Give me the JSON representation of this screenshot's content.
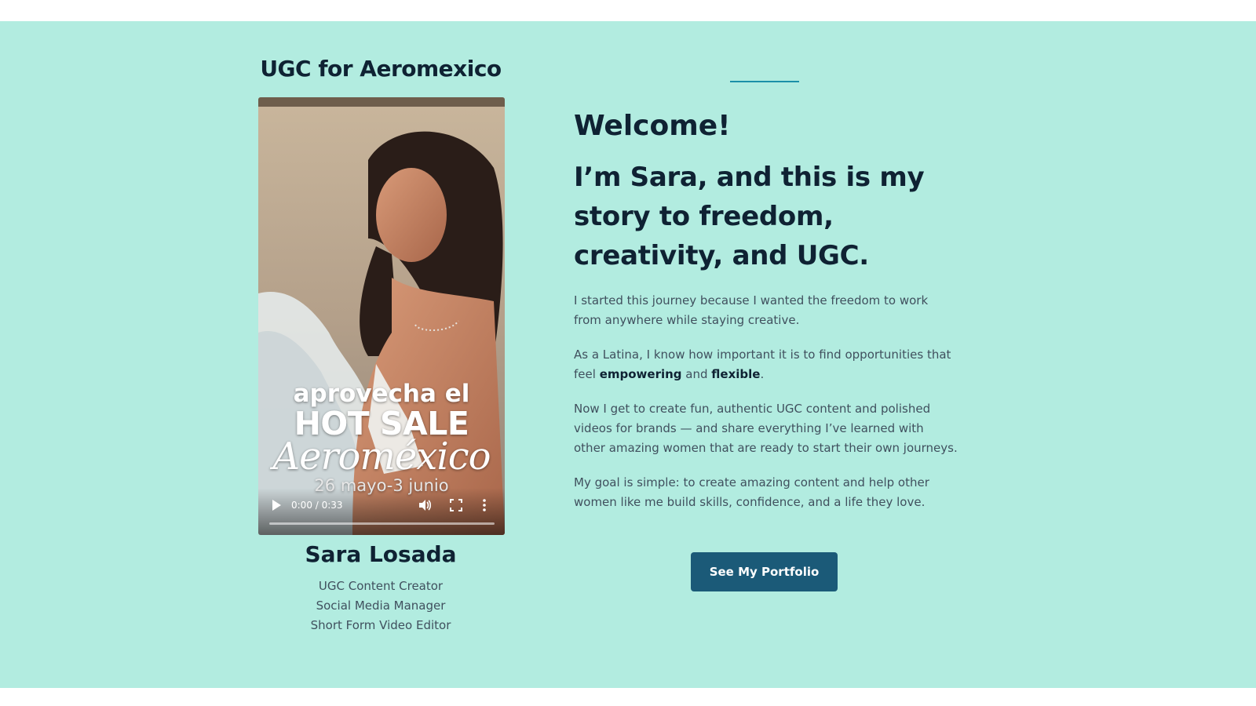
{
  "video_card": {
    "title": "UGC for Aeromexico",
    "overlay": {
      "line1": "aprovecha el",
      "line2": "HOT SALE",
      "line3": "Aeroméxico",
      "line4": "26 mayo-3 junio"
    },
    "player": {
      "time": "0:00 / 0:33",
      "progress": 0,
      "icons": [
        "play-icon",
        "volume-icon",
        "fullscreen-icon",
        "more-options-icon"
      ]
    }
  },
  "profile": {
    "name": "Sara Losada",
    "roles": [
      "UGC Content Creator",
      "Social Media Manager",
      "Short Form Video Editor"
    ]
  },
  "intro": {
    "welcome": "Welcome!",
    "headline": "I’m Sara, and this is my story to freedom, creativity, and UGC.",
    "paragraph1": "I started this journey because I wanted the freedom to work from anywhere while staying creative.",
    "paragraph2": {
      "before": "As a Latina, I know how important it is to find opportunities that feel ",
      "bold1": "empowering",
      "middle": " and ",
      "bold2": "flexible",
      "after": "."
    },
    "paragraph3": "Now I get to create fun, authentic UGC content and polished videos for brands — and share everything I’ve learned with other amazing women that are ready to start their own journeys.",
    "paragraph4": "My goal is simple: to create amazing content and help other women like me build skills, confidence, and a life they love.",
    "cta_label": "See My Portfolio"
  },
  "colors": {
    "section_bg": "#b2ece0",
    "heading": "#0f2233",
    "body_text": "#40505e",
    "accent_line": "#1c8fa8",
    "button_bg": "#1b5a78"
  }
}
